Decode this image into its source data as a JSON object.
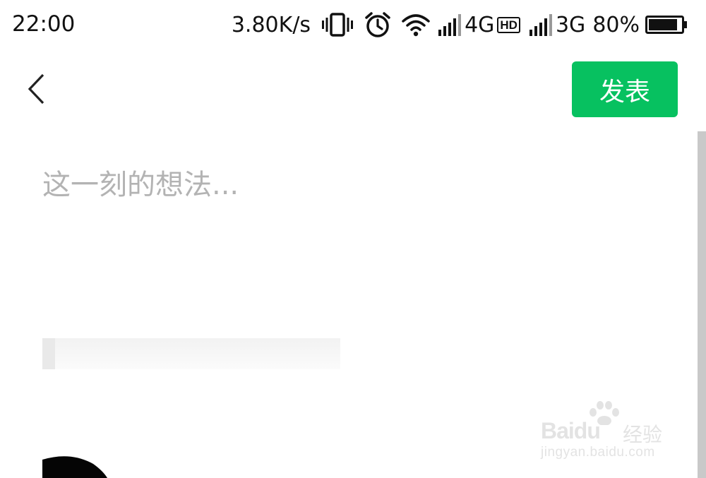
{
  "status_bar": {
    "time": "22:00",
    "net_speed": "3.80K/s",
    "network_1": "4G",
    "hd_badge": "HD",
    "network_2": "3G",
    "battery_percent": "80%",
    "icons": [
      "vibrate-icon",
      "alarm-clock-icon",
      "wifi-icon",
      "signal-icon",
      "signal-icon",
      "battery-icon"
    ]
  },
  "header": {
    "back_icon": "chevron-left-icon",
    "publish_label": "发表",
    "publish_color": "#07c160"
  },
  "compose": {
    "placeholder": "这一刻的想法...",
    "value": ""
  },
  "watermark": {
    "brand": "Bai",
    "brand_suffix": "du",
    "name": "经验",
    "url": "jingyan.baidu.com"
  }
}
